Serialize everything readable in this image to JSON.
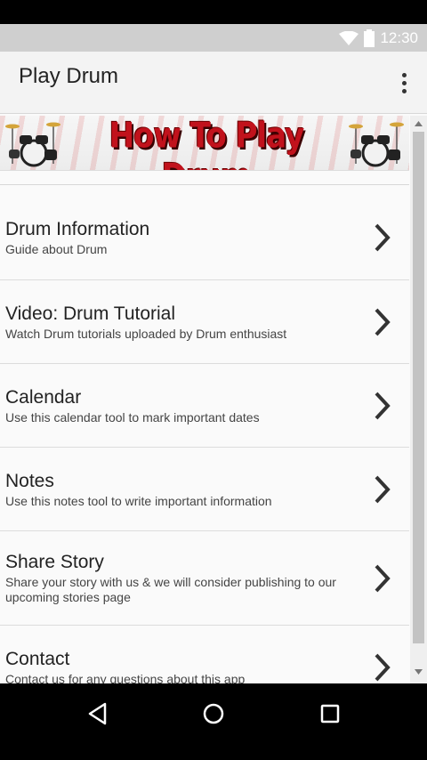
{
  "status_bar": {
    "time": "12:30",
    "icons": [
      "wifi-icon",
      "battery-icon"
    ]
  },
  "app_bar": {
    "title": "Play Drum",
    "overflow_icon": "more-vert-icon"
  },
  "banner": {
    "title": "How To Play Drum",
    "left_icon": "drum-kit-icon",
    "right_icon": "drum-kit-icon"
  },
  "list": {
    "items": [
      {
        "title": "Drum Information",
        "desc": "Guide about Drum"
      },
      {
        "title": "Video: Drum Tutorial",
        "desc": "Watch Drum tutorials uploaded by Drum enthusiast"
      },
      {
        "title": "Calendar",
        "desc": "Use this calendar tool to mark important dates"
      },
      {
        "title": "Notes",
        "desc": "Use this notes tool to write important information"
      },
      {
        "title": "Share Story",
        "desc": "Share your story with us & we will consider publishing to our upcoming stories page"
      },
      {
        "title": "Contact",
        "desc": "Contact us for any questions about this app"
      }
    ]
  },
  "colors": {
    "banner_red": "#c1121c",
    "status_bar": "#cfcfcf",
    "app_bar": "#f3f3f3"
  },
  "nav_bar": {
    "buttons": [
      "back-icon",
      "home-icon",
      "recents-icon"
    ]
  }
}
